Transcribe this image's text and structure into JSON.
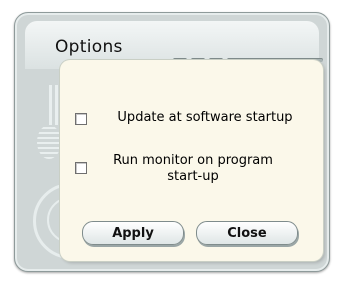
{
  "window": {
    "title": "Options"
  },
  "options": [
    {
      "label": "Update at software startup",
      "checked": false
    },
    {
      "label": "Run monitor on program start-up",
      "checked": false
    }
  ],
  "buttons": {
    "apply_label": "Apply",
    "close_label": "Close"
  }
}
